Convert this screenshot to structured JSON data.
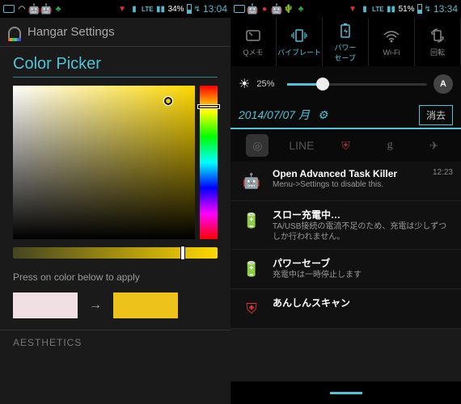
{
  "left": {
    "statusbar": {
      "battery": "34%",
      "time": "13:04",
      "net": "LTE"
    },
    "header": {
      "title": "Hangar Settings"
    },
    "section_title": "Color Picker",
    "apply_hint": "Press on color below to apply",
    "arrow": "→",
    "aesthetics": "AESTHETICS",
    "colors": {
      "hue_base": "#ffd800",
      "old_swatch": "#f0e0e4",
      "new_swatch": "#edc21a"
    }
  },
  "right": {
    "statusbar": {
      "battery": "51%",
      "time": "13:34",
      "net": "LTE"
    },
    "qs": [
      {
        "label": "Qメモ"
      },
      {
        "label": "バイブレート"
      },
      {
        "label_line1": "パワー",
        "label_line2": "セーブ"
      },
      {
        "label": "Wi-Fi"
      },
      {
        "label": "回転"
      }
    ],
    "brightness": {
      "pct": "25%",
      "auto": "A"
    },
    "date": {
      "text": "2014/07/07 月",
      "clear": "消去"
    },
    "notifications": [
      {
        "title": "Open Advanced Task Killer",
        "sub": "Menu->Settings to disable this.",
        "time": "12:23",
        "icon": "android"
      },
      {
        "title": "スロー充電中…",
        "sub": "TA/USB接続の電流不足のため、充電は少しずつしか行われません。",
        "icon": "battery"
      },
      {
        "title": "パワーセーブ",
        "sub": "充電中は一時停止します",
        "icon": "power"
      },
      {
        "title": "あんしんスキャン",
        "sub": "",
        "icon": "shield"
      }
    ]
  }
}
